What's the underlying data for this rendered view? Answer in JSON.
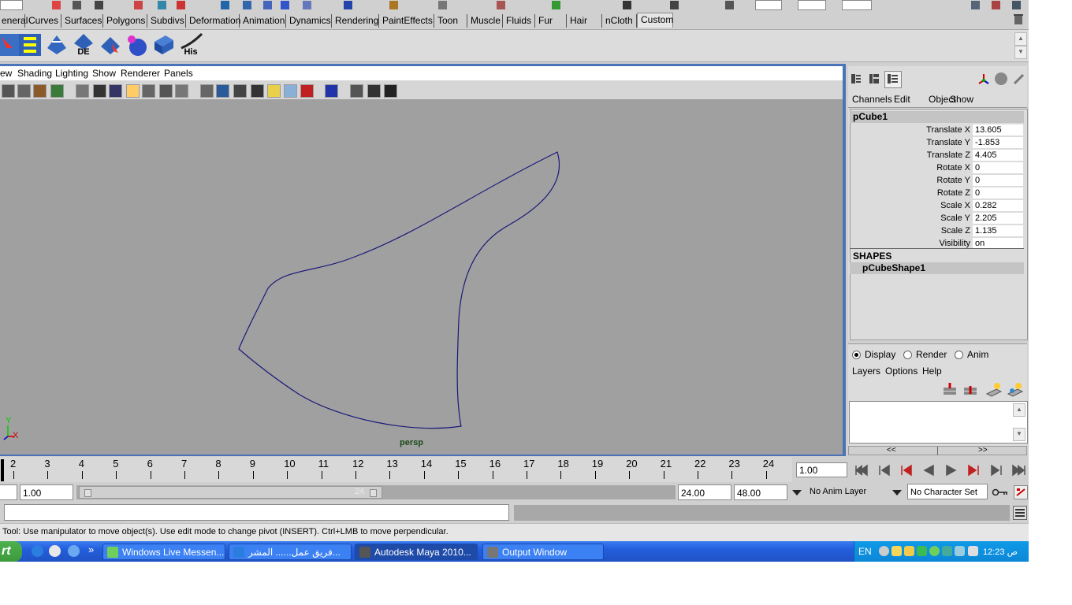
{
  "shelf": {
    "tabs": [
      "eneral",
      "Curves",
      "Surfaces",
      "Polygons",
      "Subdivs",
      "Deformation",
      "Animation",
      "Dynamics",
      "Rendering",
      "PaintEffects",
      "Toon",
      "Muscle",
      "Fluids",
      "Fur",
      "Hair",
      "nCloth",
      "Custom"
    ],
    "active_tab": "Custom",
    "button_labels": {
      "de": "DE",
      "his": "His"
    }
  },
  "viewport": {
    "menu": [
      "ew",
      "Shading",
      "Lighting",
      "Show",
      "Renderer",
      "Panels"
    ],
    "camera_label": "persp",
    "axis": {
      "y": "Y",
      "x": "X"
    },
    "colors": {
      "background": "#a0a0a0",
      "curve": "#1a1a7a",
      "border": "#4a73b8"
    }
  },
  "channel_box": {
    "menu": [
      "Channels",
      "Edit",
      "Object",
      "Show"
    ],
    "object_name": "pCube1",
    "attributes": [
      {
        "label": "Translate X",
        "value": "13.605"
      },
      {
        "label": "Translate Y",
        "value": "-1.853"
      },
      {
        "label": "Translate Z",
        "value": "4.405"
      },
      {
        "label": "Rotate X",
        "value": "0"
      },
      {
        "label": "Rotate Y",
        "value": "0"
      },
      {
        "label": "Rotate Z",
        "value": "0"
      },
      {
        "label": "Scale X",
        "value": "0.282"
      },
      {
        "label": "Scale Y",
        "value": "2.205"
      },
      {
        "label": "Scale Z",
        "value": "1.135"
      },
      {
        "label": "Visibility",
        "value": "on"
      }
    ],
    "shapes_header": "SHAPES",
    "shape_name": "pCubeShape1"
  },
  "layer_editor": {
    "modes": [
      "Display",
      "Render",
      "Anim"
    ],
    "selected_mode": "Display",
    "menu": [
      "Layers",
      "Options",
      "Help"
    ],
    "nav_prev": "<<",
    "nav_next": ">>"
  },
  "timeline": {
    "ticks": [
      "2",
      "3",
      "4",
      "5",
      "6",
      "7",
      "8",
      "9",
      "10",
      "11",
      "12",
      "13",
      "14",
      "15",
      "16",
      "17",
      "18",
      "19",
      "20",
      "21",
      "22",
      "23",
      "24"
    ],
    "current_frame": "1.00"
  },
  "range": {
    "start": "1.00",
    "ghost_end": "24",
    "end": "24.00",
    "anim_end": "48.00",
    "anim_layer": "No Anim Layer",
    "character_set": "No Character Set"
  },
  "help_line": "Tool: Use manipulator to move object(s). Use edit mode to change pivot (INSERT).  Ctrl+LMB to move perpendicular.",
  "taskbar": {
    "start": "rt",
    "overflow": "»",
    "tasks": [
      "Windows Live Messen...",
      "فريق عمل...... المشر...",
      "Autodesk Maya 2010...",
      "Output Window"
    ],
    "active_task": "Autodesk Maya 2010...",
    "lang": "EN",
    "clock": "12:23 ص"
  }
}
